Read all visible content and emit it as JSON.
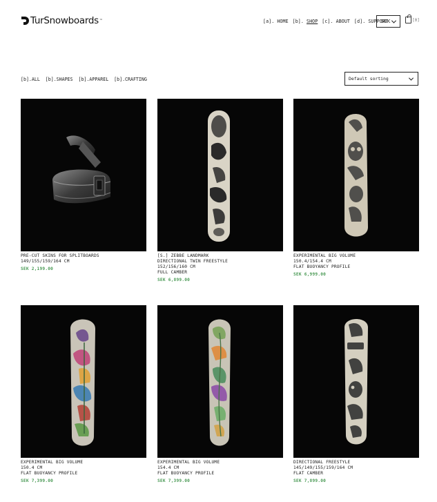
{
  "brand": {
    "name": "TurSnowboards",
    "tm": "™"
  },
  "nav": [
    {
      "tag": "[a].",
      "label": "HOME"
    },
    {
      "tag": "[b].",
      "label": "SHOP"
    },
    {
      "tag": "[c].",
      "label": "ABOUT"
    },
    {
      "tag": "[d].",
      "label": "SUPPORT"
    }
  ],
  "currency": "SEK",
  "cart": {
    "count": "[0]"
  },
  "filters": [
    "[b].ALL",
    "[b].SHAPES",
    "[b].APPAREL",
    "[b].CRAFTING"
  ],
  "sort": {
    "selected": "Default sorting"
  },
  "products": [
    {
      "name": "PRE-CUT SKINS FOR SPLITBOARDS",
      "lines": [
        "149/155/159/164 CM"
      ],
      "price": "SEK 2,199.00",
      "image": "skins-roll"
    },
    {
      "name": "[S.] ZEBBE LANDMARK",
      "lines": [
        "DIRECTIONAL TWIN FREESTYLE",
        "152/156/160 CM",
        "FULL CAMBER"
      ],
      "price": "SEK 6,899.00",
      "image": "birds-board"
    },
    {
      "name": "EXPERIMENTAL BIG VOLUME",
      "lines": [
        "150.4/154.4 CM",
        "FLAT BUOYANCY PROFILE"
      ],
      "price": "SEK 6,999.00",
      "image": "owl-board"
    },
    {
      "name": "EXPERIMENTAL BIG VOLUME",
      "lines": [
        "150.4 CM",
        "FLAT BUOYANCY PROFILE"
      ],
      "price": "SEK 7,399.00",
      "image": "floral-board"
    },
    {
      "name": "EXPERIMENTAL BIG VOLUME",
      "lines": [
        "154.4 CM",
        "FLAT BUOYANCY PROFILE"
      ],
      "price": "SEK 7,399.00",
      "image": "leaf-board"
    },
    {
      "name": "DIRECTIONAL FREESTYLE",
      "lines": [
        "145/149/155/159/164 CM",
        "FLAT CAMBER"
      ],
      "price": "SEK 7,899.00",
      "image": "duck-board"
    }
  ]
}
